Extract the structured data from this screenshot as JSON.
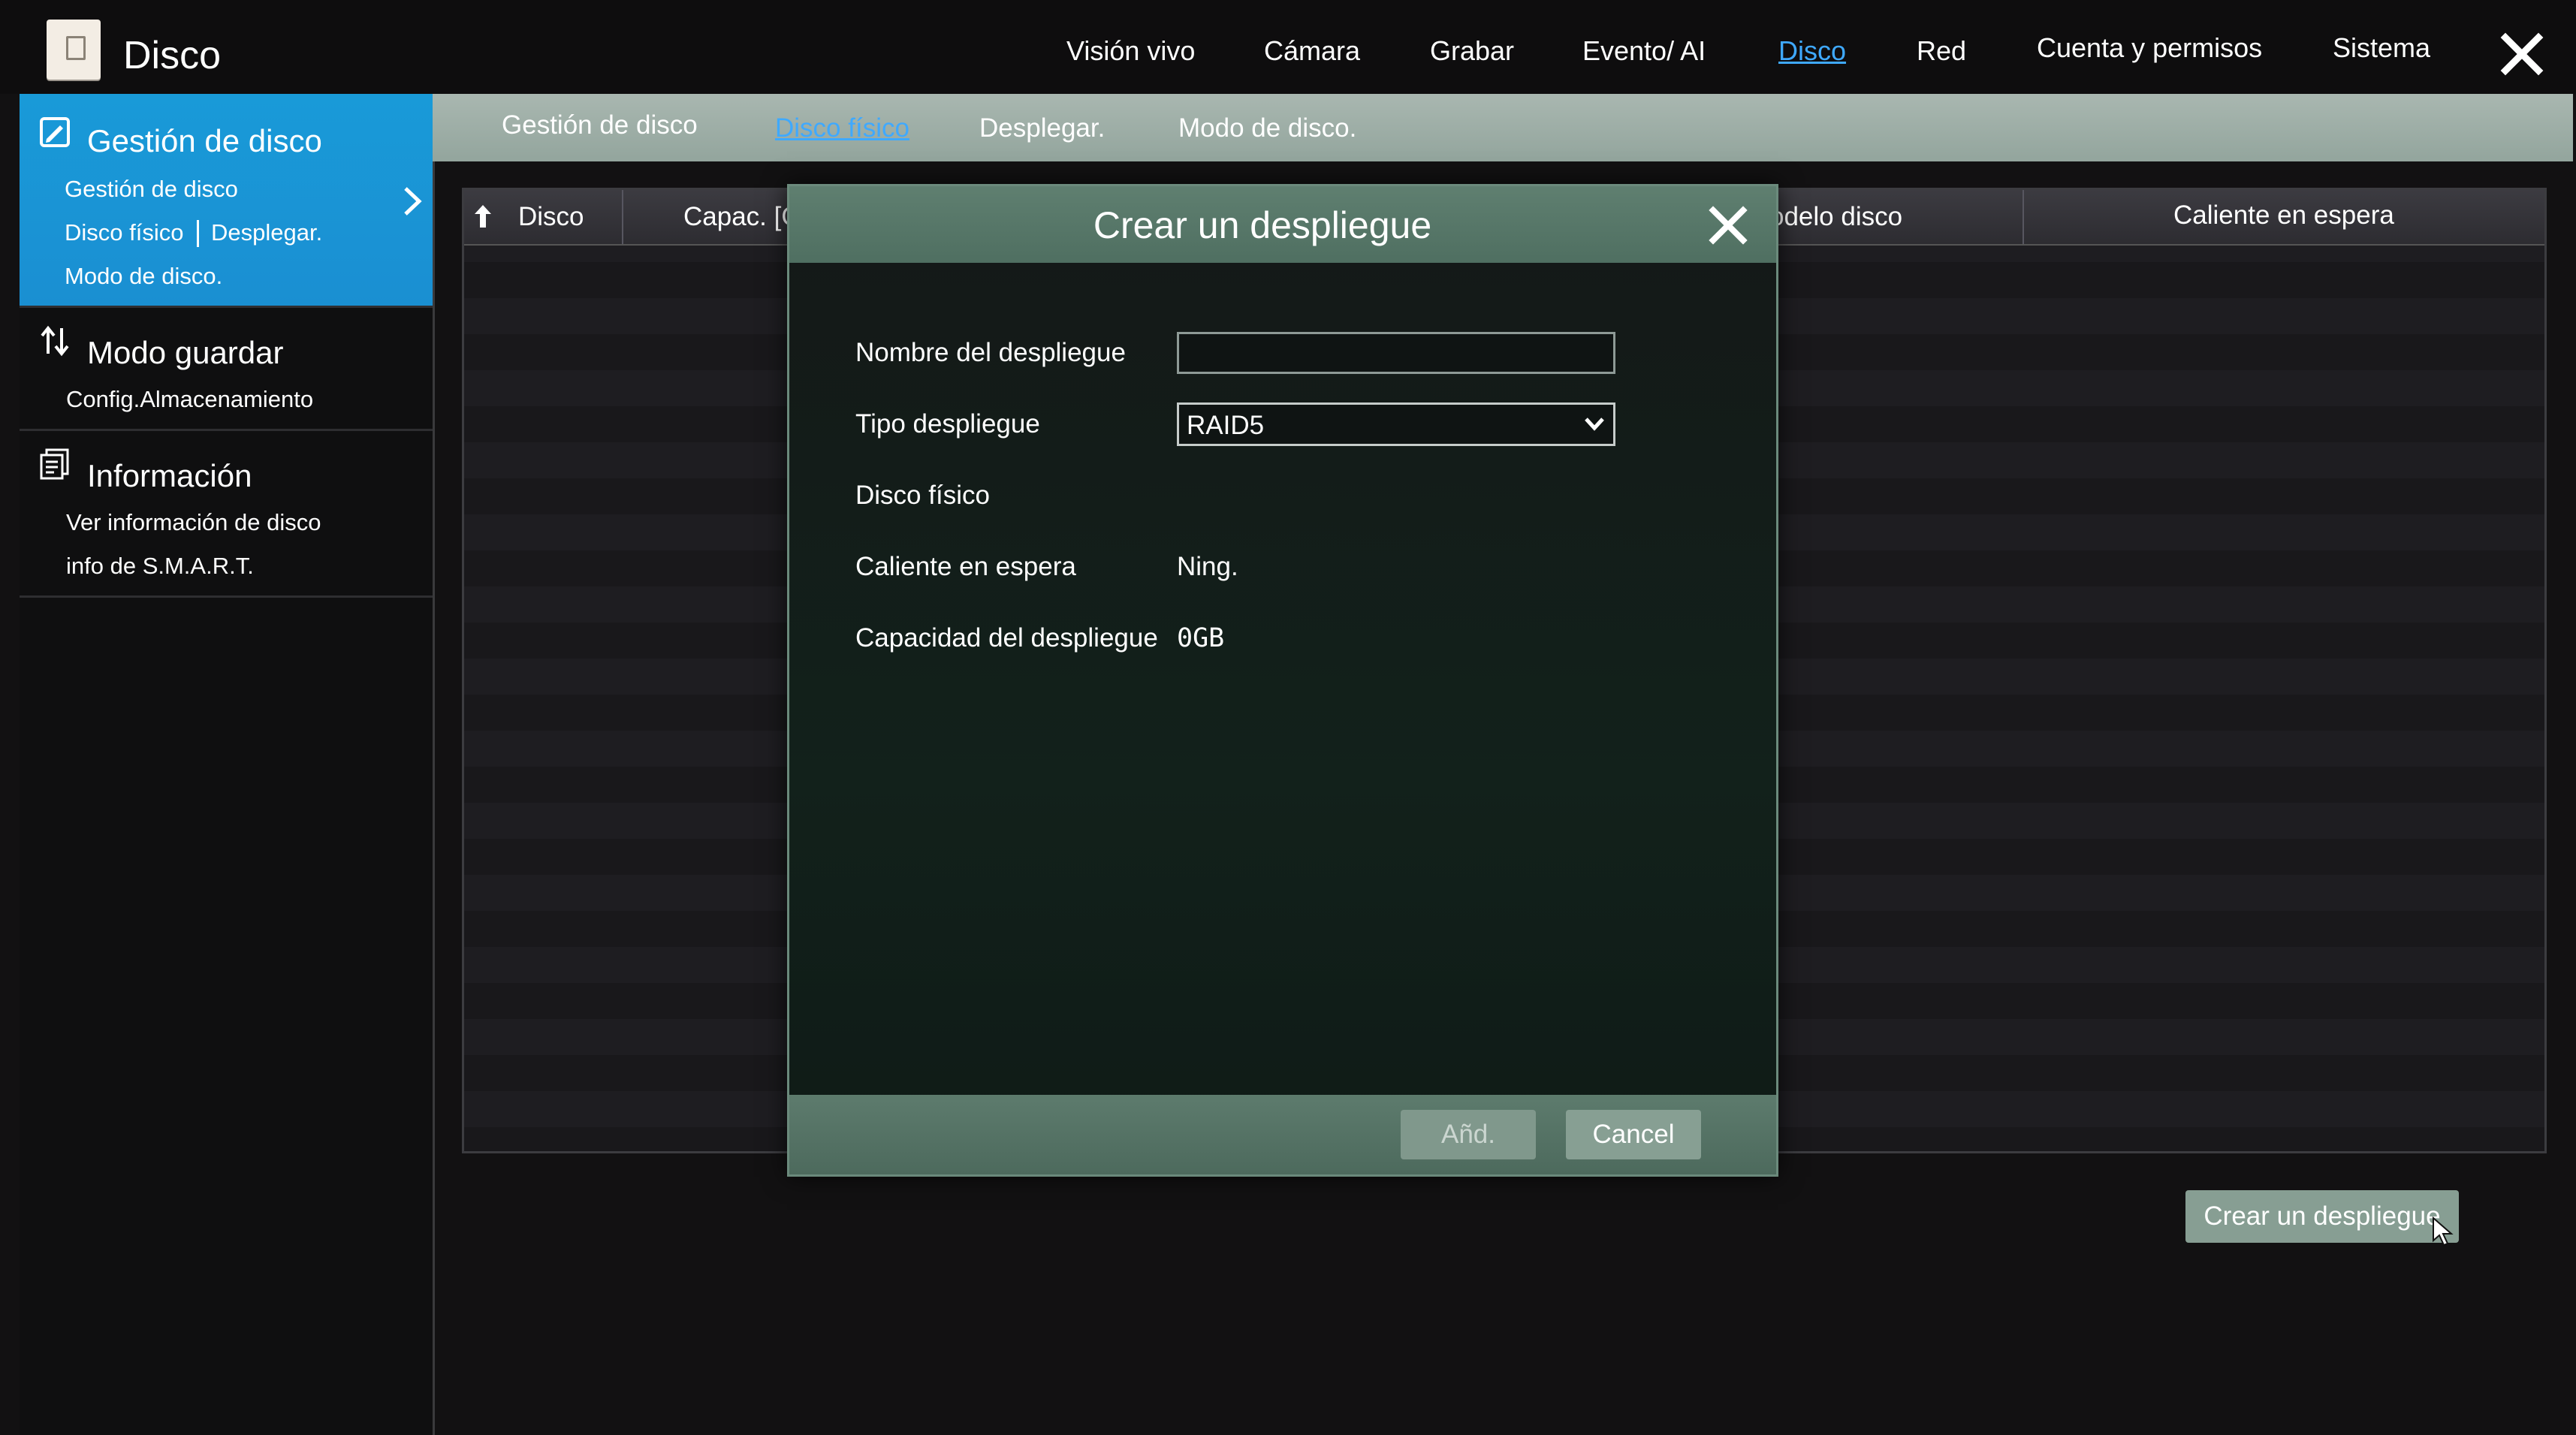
{
  "app": {
    "title": "Disco"
  },
  "nav": [
    {
      "label": "Visión vivo",
      "active": false
    },
    {
      "label": "Cámara",
      "active": false
    },
    {
      "label": "Grabar",
      "active": false
    },
    {
      "label": "Evento/ AI",
      "active": false
    },
    {
      "label": "Disco",
      "active": true
    },
    {
      "label": "Red",
      "active": false
    },
    {
      "label": "Cuenta y permisos",
      "active": false
    },
    {
      "label": "Sistema",
      "active": false
    }
  ],
  "sidebar": {
    "sections": [
      {
        "title": "Gestión de disco",
        "links": [
          "Gestión de disco",
          "Disco físico",
          "Desplegar.",
          "Modo de disco."
        ],
        "active": true
      },
      {
        "title": "Modo guardar",
        "links": [
          "Config.Almacenamiento"
        ],
        "active": false
      },
      {
        "title": "Información",
        "links": [
          "Ver información de disco",
          "info de S.M.A.R.T."
        ],
        "active": false
      }
    ]
  },
  "subtabs": [
    {
      "label": "Gestión de disco",
      "active": false
    },
    {
      "label": "Disco físico",
      "active": true
    },
    {
      "label": "Desplegar.",
      "active": false
    },
    {
      "label": "Modo de disco.",
      "active": false
    }
  ],
  "table": {
    "columns": [
      "Disco",
      "Capac. [G",
      "odelo disco",
      "Caliente en espera"
    ]
  },
  "create_button": "Crear un despliegue",
  "modal": {
    "title": "Crear un despliegue",
    "fields": {
      "name_label": "Nombre del despliegue",
      "name_value": "",
      "type_label": "Tipo despliegue",
      "type_value": "RAID5",
      "physical_label": "Disco físico",
      "hotspare_label": "Caliente en espera",
      "hotspare_value": "Ning.",
      "capacity_label": "Capacidad del despliegue",
      "capacity_value": "0GB"
    },
    "buttons": {
      "add": "Añd.",
      "cancel": "Cancel"
    }
  },
  "colors": {
    "accent_blue": "#1a95d6",
    "link_blue": "#3fa9ff",
    "dialog_green": "#5f7f70"
  }
}
